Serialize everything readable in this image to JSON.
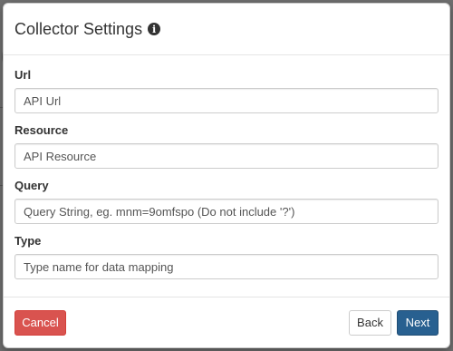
{
  "modal": {
    "title": "Collector Settings",
    "title_icon": "info-circle-icon"
  },
  "fields": {
    "url": {
      "label": "Url",
      "placeholder": "API Url"
    },
    "resource": {
      "label": "Resource",
      "placeholder": "API Resource"
    },
    "query": {
      "label": "Query",
      "placeholder": "Query String, eg. mnm=9omfspo (Do not include '?')"
    },
    "type": {
      "label": "Type",
      "placeholder": "Type name for data mapping"
    }
  },
  "footer": {
    "cancel_label": "Cancel",
    "back_label": "Back",
    "next_label": "Next"
  },
  "colors": {
    "cancel": "#d9534f",
    "next": "#286090",
    "overlay": "#6f6f6f"
  }
}
